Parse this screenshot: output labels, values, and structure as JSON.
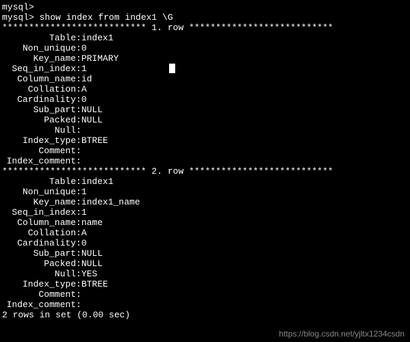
{
  "prompt_prefix": "mysql> ",
  "prev_prompt": "mysql>",
  "command": "show index from index1 \\G",
  "separator_row1": "*************************** 1. row ***************************",
  "separator_row2": "*************************** 2. row ***************************",
  "rows": [
    {
      "fields": [
        {
          "label": "Table",
          "value": "index1"
        },
        {
          "label": "Non_unique",
          "value": "0"
        },
        {
          "label": "Key_name",
          "value": "PRIMARY"
        },
        {
          "label": "Seq_in_index",
          "value": "1"
        },
        {
          "label": "Column_name",
          "value": "id"
        },
        {
          "label": "Collation",
          "value": "A"
        },
        {
          "label": "Cardinality",
          "value": "0"
        },
        {
          "label": "Sub_part",
          "value": "NULL"
        },
        {
          "label": "Packed",
          "value": "NULL"
        },
        {
          "label": "Null",
          "value": ""
        },
        {
          "label": "Index_type",
          "value": "BTREE"
        },
        {
          "label": "Comment",
          "value": ""
        },
        {
          "label": "Index_comment",
          "value": ""
        }
      ]
    },
    {
      "fields": [
        {
          "label": "Table",
          "value": "index1"
        },
        {
          "label": "Non_unique",
          "value": "1"
        },
        {
          "label": "Key_name",
          "value": "index1_name"
        },
        {
          "label": "Seq_in_index",
          "value": "1"
        },
        {
          "label": "Column_name",
          "value": "name"
        },
        {
          "label": "Collation",
          "value": "A"
        },
        {
          "label": "Cardinality",
          "value": "0"
        },
        {
          "label": "Sub_part",
          "value": "NULL"
        },
        {
          "label": "Packed",
          "value": "NULL"
        },
        {
          "label": "Null",
          "value": "YES"
        },
        {
          "label": "Index_type",
          "value": "BTREE"
        },
        {
          "label": "Comment",
          "value": ""
        },
        {
          "label": "Index_comment",
          "value": ""
        }
      ]
    }
  ],
  "footer": "2 rows in set (0.00 sec)",
  "watermark": "https://blog.csdn.net/yjltx1234csdn"
}
